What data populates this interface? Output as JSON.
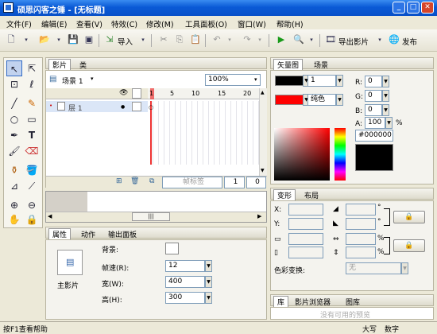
{
  "window": {
    "title": "硕思闪客之锤 - [无标题]"
  },
  "menu": [
    "文件(F)",
    "编辑(E)",
    "查看(V)",
    "特效(C)",
    "修改(M)",
    "工具面板(O)",
    "窗口(W)",
    "帮助(H)"
  ],
  "toolbar": {
    "import_label": "导入",
    "export_label": "导出影片",
    "publish_label": "发布"
  },
  "movie_panel": {
    "tabs": [
      "影片",
      "类"
    ],
    "scene_label": "场景 1",
    "zoom": "100%",
    "layer_name": "层 1",
    "ruler_ticks": [
      "1",
      "5",
      "10",
      "15",
      "20"
    ],
    "frame_label_placeholder": "帧标签",
    "current_frame": "1",
    "frame_count": "0"
  },
  "properties": {
    "tabs": [
      "属性",
      "动作",
      "输出面板"
    ],
    "main_movie_label": "主影片",
    "bg_label": "背景:",
    "fps_label": "帧速(R):",
    "fps": "12",
    "width_label": "宽(W):",
    "width": "400",
    "height_label": "高(H):",
    "height": "300"
  },
  "color_panel": {
    "tabs": [
      "矢量图",
      "场景"
    ],
    "stroke_width": "1",
    "fill_type": "纯色",
    "r_label": "R:",
    "g_label": "G:",
    "b_label": "B:",
    "a_label": "A:",
    "r": "0",
    "g": "0",
    "b": "0",
    "a": "100",
    "percent": "%",
    "hex": "#000000",
    "fill_color": "#ff0000",
    "stroke_color": "#000000"
  },
  "transform_panel": {
    "tabs": [
      "变形",
      "布局"
    ],
    "x_label": "X:",
    "y_label": "Y:",
    "degree": "°",
    "percent": "%",
    "color_transform_label": "色彩变换:",
    "color_transform_value": "无"
  },
  "library_panel": {
    "tabs": [
      "库",
      "影片浏览器",
      "图库"
    ],
    "empty_text": "没有可用的预览"
  },
  "status": {
    "help": "按F1查看帮助",
    "caps": "大写",
    "num": "数字"
  }
}
